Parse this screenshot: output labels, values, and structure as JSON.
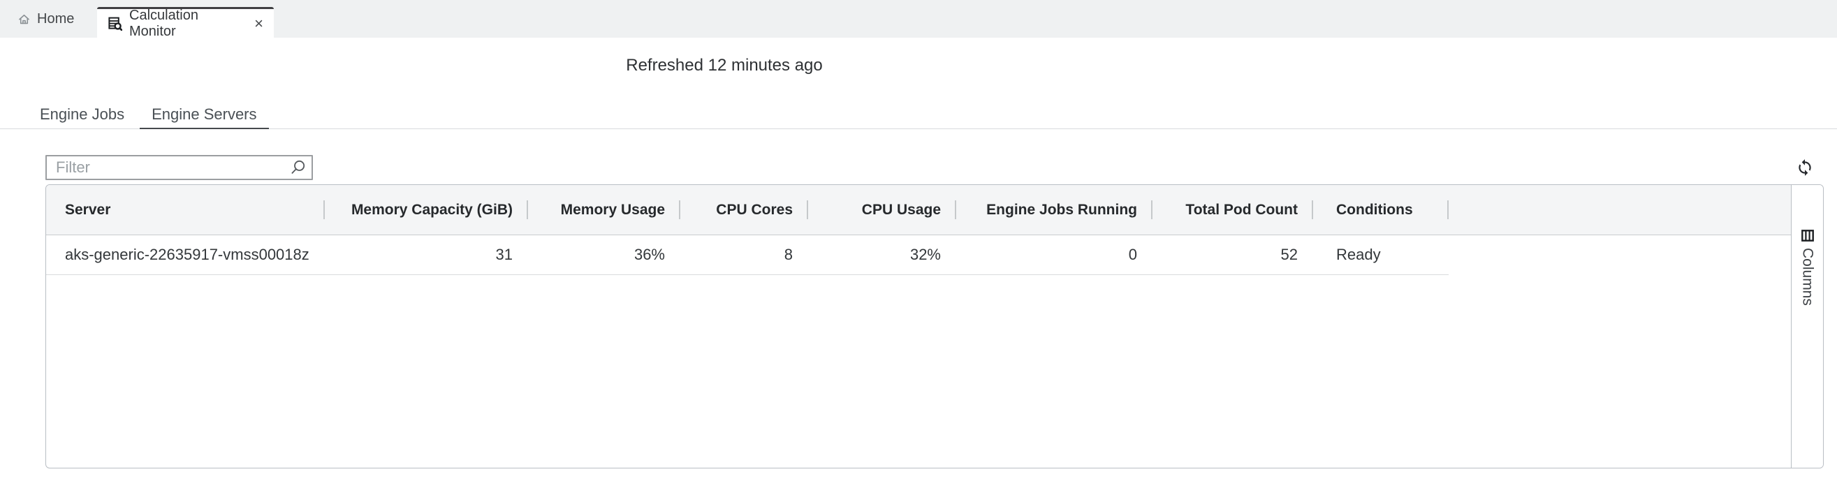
{
  "topbar": {
    "home_label": "Home",
    "tab_title": "Calculation Monitor",
    "close_glyph": "×"
  },
  "status": {
    "refreshed_text": "Refreshed 12 minutes ago"
  },
  "view_tabs": [
    {
      "label": "Engine Jobs",
      "active": false
    },
    {
      "label": "Engine Servers",
      "active": true
    }
  ],
  "toolbar": {
    "filter_placeholder": "Filter"
  },
  "columns_panel": {
    "label": "Columns"
  },
  "table": {
    "columns": [
      {
        "label": "Server",
        "align": "left"
      },
      {
        "label": "Memory Capacity (GiB)",
        "align": "right"
      },
      {
        "label": "Memory Usage",
        "align": "right"
      },
      {
        "label": "CPU Cores",
        "align": "right"
      },
      {
        "label": "CPU Usage",
        "align": "right"
      },
      {
        "label": "Engine Jobs Running",
        "align": "right"
      },
      {
        "label": "Total Pod Count",
        "align": "right"
      },
      {
        "label": "Conditions",
        "align": "left"
      }
    ],
    "rows": [
      {
        "cells": [
          "aks-generic-22635917-vmss00018z",
          "31",
          "36%",
          "8",
          "32%",
          "0",
          "52",
          "Ready"
        ]
      }
    ]
  },
  "icons": {
    "home-icon": "house outline",
    "table-search-icon": "table with magnifier",
    "close-icon": "×",
    "search-icon": "magnifier",
    "refresh-icon": "circular sync arrows",
    "columns-icon": "table columns grid"
  },
  "colors": {
    "topbar_bg": "#eff1f2",
    "active_tab_top_border": "#3f3f42",
    "header_row_bg": "#f4f5f6",
    "card_border": "#b9bec4",
    "active_view_tab_underline": "#45494d"
  }
}
